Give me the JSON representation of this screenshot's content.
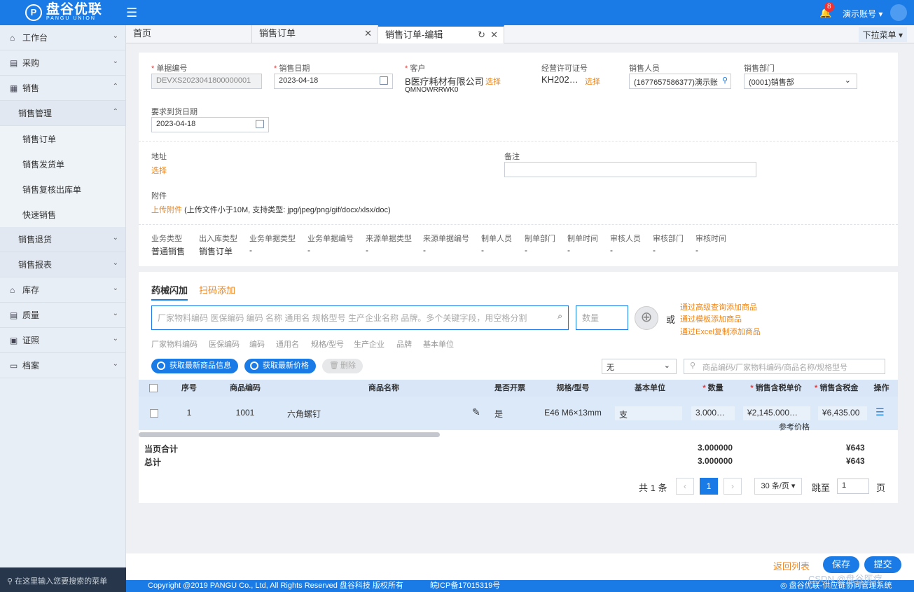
{
  "app": {
    "brand": "盘谷优联",
    "brand_sub": "PANGU UNION",
    "logo_char": "P",
    "notif_count": "8",
    "account": "演示账号 ▾"
  },
  "sidebar": {
    "items": [
      {
        "label": "工作台"
      },
      {
        "label": "采购"
      },
      {
        "label": "销售"
      }
    ],
    "sub": {
      "label": "销售管理"
    },
    "leaves": [
      {
        "label": "销售订单"
      },
      {
        "label": "销售发货单"
      },
      {
        "label": "销售复核出库单"
      },
      {
        "label": "快速销售"
      }
    ],
    "sub2": [
      {
        "label": "销售退货"
      },
      {
        "label": "销售报表"
      }
    ],
    "items2": [
      {
        "label": "库存"
      },
      {
        "label": "质量"
      },
      {
        "label": "证照"
      },
      {
        "label": "档案"
      }
    ],
    "search_placeholder": "在这里输入您要搜索的菜单"
  },
  "tabs": [
    {
      "label": "首页"
    },
    {
      "label": "销售订单"
    },
    {
      "label": "销售订单-编辑"
    }
  ],
  "tab_dropdown": "下拉菜单 ▾",
  "form": {
    "doc_no_label": "单据编号",
    "doc_no": "DEVXS2023041800000001",
    "sale_date_label": "销售日期",
    "sale_date": "2023-04-18",
    "customer_label": "客户",
    "customer": "B医疗耗材有限公司",
    "customer_code": "QMNOWRRWK0",
    "select": "选择",
    "license_label": "经营许可证号",
    "license": "KH202…",
    "salesman_label": "销售人员",
    "salesman": "(1677657586377)演示账",
    "dept_label": "销售部门",
    "dept": "(0001)销售部",
    "delivery_label": "要求到货日期",
    "delivery_date": "2023-04-18",
    "address_label": "地址",
    "remark_label": "备注",
    "attach_label": "附件",
    "upload": "上传附件",
    "upload_hint": "(上传文件小于10M, 支持类型: jpg/jpeg/png/gif/docx/xlsx/doc)"
  },
  "meta": {
    "headers": [
      "业务类型",
      "出入库类型",
      "业务单据类型",
      "业务单据编号",
      "来源单据类型",
      "来源单据编号",
      "制单人员",
      "制单部门",
      "制单时间",
      "审核人员",
      "审核部门",
      "审核时间"
    ],
    "values": [
      "普通销售",
      "销售订单",
      "-",
      "-",
      "-",
      "-",
      "-",
      "-",
      "-",
      "-",
      "-",
      "-"
    ]
  },
  "goods": {
    "tab_active": "药械闪加",
    "tab_other": "扫码添加",
    "search_placeholder": "厂家物料编码 医保编码 编码 名称 通用名 规格型号 生产企业名称 品牌。多个关键字段，用空格分割",
    "qty_placeholder": "数量",
    "or": "或",
    "links": [
      "通过高级查询添加商品",
      "通过模板添加商品",
      "通过Excel复制添加商品"
    ],
    "fields": [
      "厂家物料编码",
      "医保编码",
      "编码",
      "通用名",
      "规格/型号",
      "生产企业",
      "品牌",
      "基本单位"
    ],
    "btn_refresh_info": "获取最新商品信息",
    "btn_refresh_price": "获取最新价格",
    "btn_delete": "删除",
    "filter_select": "无",
    "filter_placeholder": "商品编码/厂家物料编码/商品名称/规格型号"
  },
  "table": {
    "headers": {
      "seq": "序号",
      "code": "商品编码",
      "name": "商品名称",
      "invoice": "是否开票",
      "spec": "规格/型号",
      "unit": "基本单位",
      "qty": "数量",
      "price": "销售含税单价",
      "amount": "销售含税金",
      "op": "操作"
    },
    "rows": [
      {
        "seq": "1",
        "code": "1001",
        "name": "六角螺钉",
        "invoice": "是",
        "spec": "E46 M6×13mm",
        "unit": "支",
        "qty": "3.000…",
        "price": "¥2,145.000…",
        "amount": "¥6,435.00",
        "ref": "参考价格"
      }
    ],
    "page_total_label": "当页合计",
    "total_label": "总计",
    "page_total_qty": "3.000000",
    "total_qty": "3.000000",
    "page_total_amount": "¥643",
    "total_amount": "¥643"
  },
  "pagination": {
    "total": "共 1 条",
    "current": "1",
    "size": "30 条/页 ▾",
    "goto": "跳至",
    "page_value": "1",
    "page": "页"
  },
  "actions": {
    "back": "返回列表",
    "save": "保存",
    "submit": "提交"
  },
  "footer": {
    "copyright": "Copyright @2019 PANGU Co., Ltd, All Rights Reserved 盘谷科技 版权所有",
    "icp": "皖ICP备17015319号",
    "system": "盘谷优联-供应链协同管理系统",
    "csdn": "CSDN @盘谷医疗"
  }
}
